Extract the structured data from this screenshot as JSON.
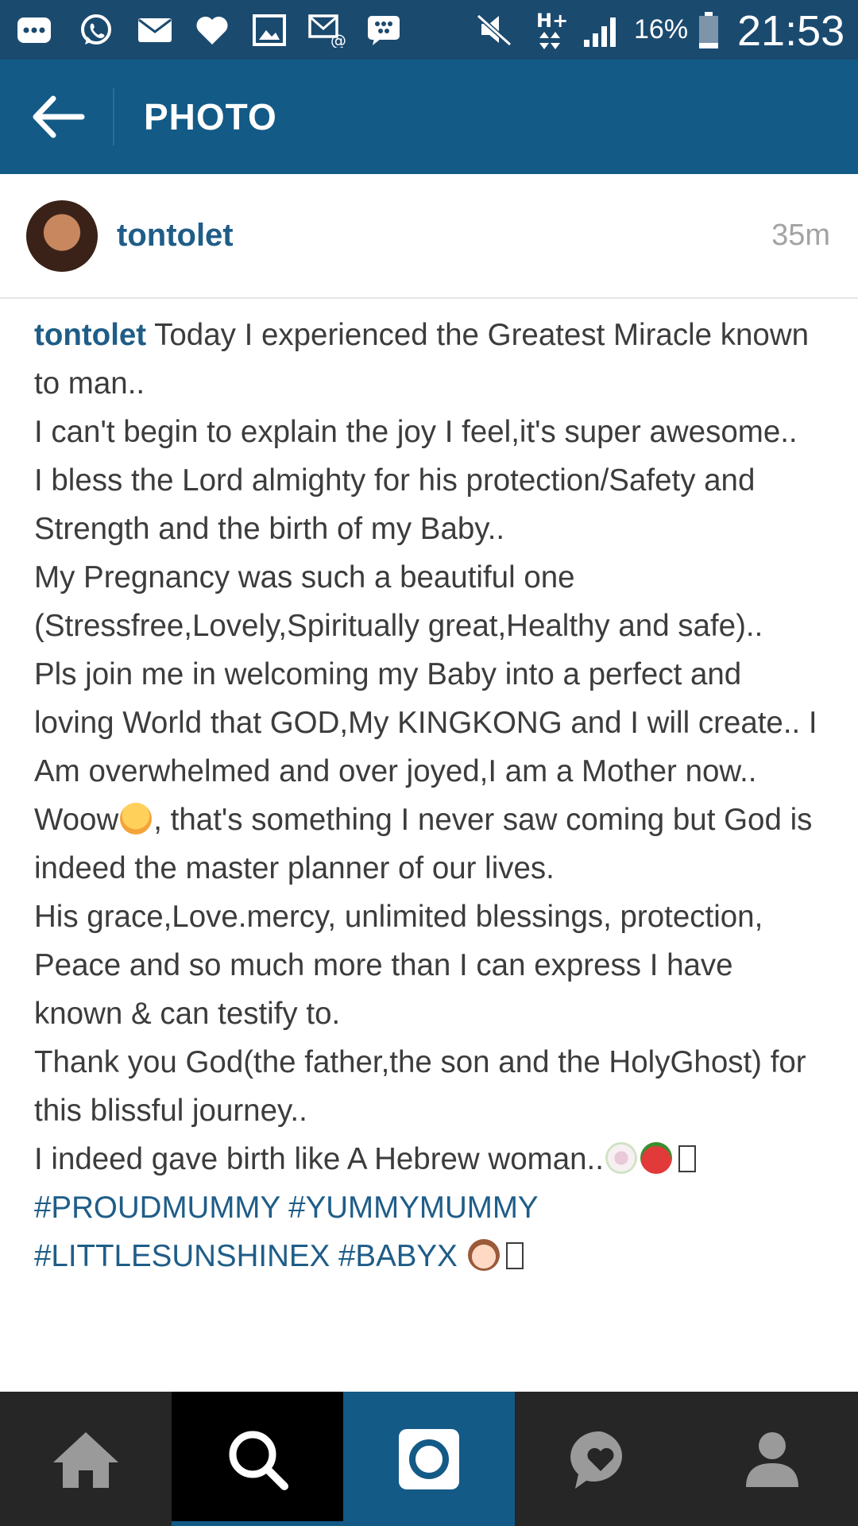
{
  "status_bar": {
    "battery_percent": "16%",
    "time": "21:53",
    "icons": [
      "more-icon",
      "whatsapp-icon",
      "mail-icon",
      "heart-icon",
      "gallery-icon",
      "email-sync-icon",
      "bbm-icon",
      "mute-icon",
      "hplus-data-icon",
      "signal-icon",
      "battery-icon"
    ]
  },
  "app_bar": {
    "title": "PHOTO",
    "back_icon": "arrow-back-icon"
  },
  "post": {
    "username": "tontolet",
    "time_ago": "35m"
  },
  "caption": {
    "username": "tontolet",
    "lines": [
      "Today I experienced the Greatest Miracle known to man..",
      "I can't begin to explain the joy I feel,it's super awesome..",
      "I bless the Lord almighty for his protection/Safety and Strength and the birth of my Baby..",
      "My Pregnancy was such a beautiful one (Stressfree,Lovely,Spiritually great,Healthy and safe)..",
      "Pls join me in welcoming my Baby into a perfect and loving World that GOD,My KINGKONG and I will create.. I Am overwhelmed and over joyed,I am a Mother now..",
      "Woow",
      ", that's something I never saw coming but God is indeed the master planner of our lives.",
      "His grace,Love.mercy, unlimited blessings, protection, Peace and so much more than I can express I have known & can testify to.",
      "Thank you God(the father,the son and the HolyGhost) for this blissful journey..",
      "I indeed gave birth like A Hebrew woman.."
    ],
    "hashtags_1": [
      "#PROUDMUMMY",
      "#YUMMYMUMMY"
    ],
    "hashtags_2": [
      "#LITTLESUNSHINEX",
      "#BABYX"
    ],
    "emoji_names": [
      "pensive-face-emoji",
      "bouquet-emoji",
      "strawberry-emoji",
      "baby-emoji"
    ]
  },
  "bottom_nav": {
    "tabs": [
      "home-icon",
      "search-icon",
      "camera-icon",
      "activity-heart-icon",
      "profile-icon"
    ],
    "active": "search-icon"
  },
  "colors": {
    "status_bar": "#1b4a6f",
    "app_bar": "#135a87",
    "link": "#1f5d88",
    "bottom_nav": "#262626"
  }
}
